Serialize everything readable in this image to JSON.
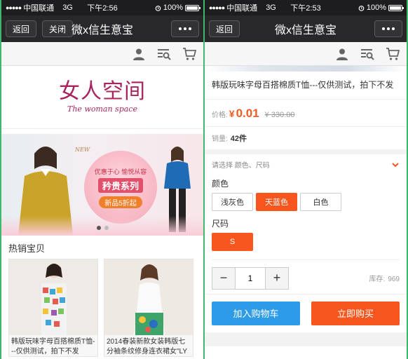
{
  "status": {
    "signal": "●●●●●",
    "carrier": "中国联通",
    "network": "3G",
    "battery": "100%"
  },
  "left": {
    "time": "下午2:56",
    "nav": {
      "back": "返回",
      "close": "关闭",
      "title": "微x信生意宝"
    },
    "logo": {
      "cn": "女人空间",
      "en": "The woman space"
    },
    "banner": {
      "tag": "NEW",
      "line1": "优惠于心 愉悦从容",
      "line2": "矜贵系列",
      "line3": "新品5折起"
    },
    "section_title": "热销宝贝",
    "products": [
      {
        "name": "韩版玩味字母百搭棉质T恤---仅供测试，拍下不发"
      },
      {
        "name": "2014春装新款女装韩版七分袖条纹修身连衣裙女\"LY"
      }
    ]
  },
  "right": {
    "time": "下午2:53",
    "nav": {
      "back": "返回",
      "title": "微x信生意宝"
    },
    "product_title": "韩版玩味字母百搭棉质T恤---仅供测试，拍下不发",
    "price": {
      "label": "价格:",
      "currency": "¥",
      "value": "0.01",
      "original": "¥ 330.00"
    },
    "sales": {
      "label": "销量:",
      "value": "42件"
    },
    "options": {
      "prompt": "请选择 颜色、尺码",
      "color_label": "颜色",
      "colors": [
        "浅灰色",
        "天蓝色",
        "白色"
      ],
      "selected_color": "天蓝色",
      "size_label": "尺码",
      "sizes": [
        "S"
      ],
      "selected_size": "S"
    },
    "quantity": {
      "minus": "−",
      "value": "1",
      "plus": "+"
    },
    "stock": {
      "label": "库存:",
      "value": "969"
    },
    "buttons": {
      "cart": "加入购物车",
      "buy": "立即购买"
    }
  },
  "colors": {
    "accent": "#f7561e",
    "blue": "#2d9be8",
    "navbar": "#28282b",
    "logo": "#a8245e",
    "frame": "#3cb96a"
  }
}
